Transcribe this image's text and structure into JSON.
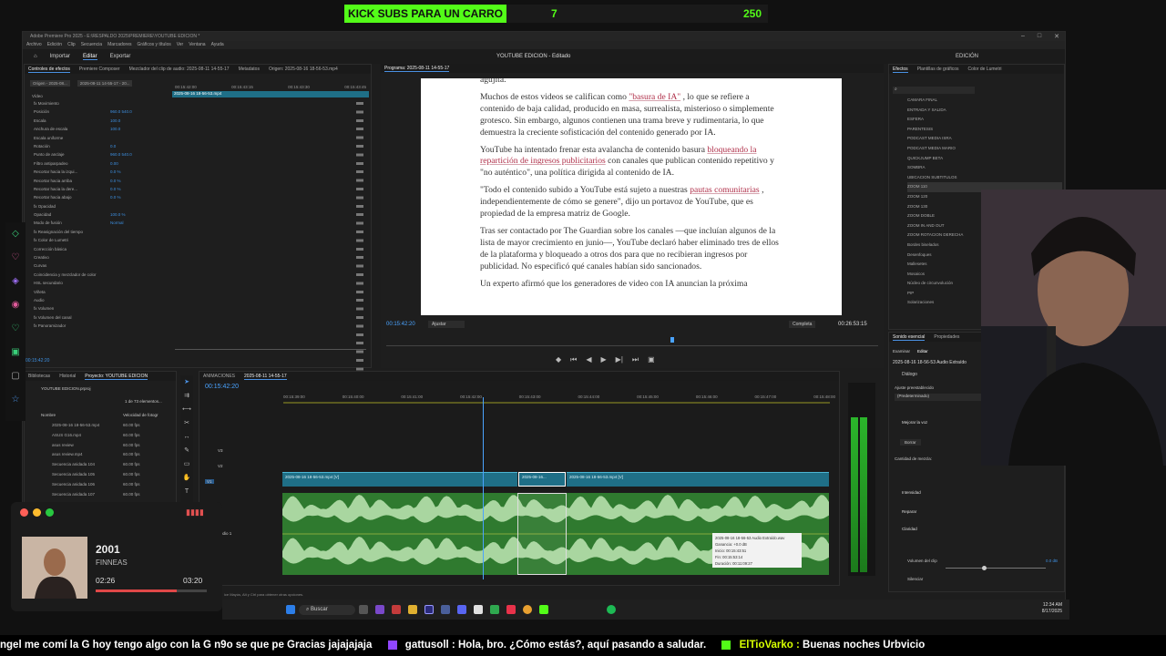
{
  "overlay": {
    "goal_label": "KICK SUBS PARA UN CARRO",
    "goal_current": "7",
    "goal_target": "250"
  },
  "window": {
    "title": "Adobe Premiere Pro 2025 - E:\\RESPALDO 2025\\PREMIERE\\YOUTUBE EDICION *",
    "center_title": "YOUTUBE EDICION - Editado",
    "menu": [
      "Archivo",
      "Edición",
      "Clip",
      "Secuencia",
      "Marcadores",
      "Gráficos y títulos",
      "Ver",
      "Ventana",
      "Ayuda"
    ],
    "workspaces": [
      "Importar",
      "Editar",
      "Exportar"
    ],
    "edicion_label": "EDICIÓN"
  },
  "effect_controls": {
    "tabs": [
      "Controles de efectos",
      "Premiere Composer",
      "Mezclador del clip de audio: 2025-08-11 14-55-17",
      "Metadatos"
    ],
    "source_label": "Origen: 2025-08-16 18-56-53.mp4",
    "clip_a": "Origen - 2025-08...",
    "clip_b": "2025-08-11 14-55-17 - 20...",
    "ruler": [
      "00:15:42:00",
      "00:15:43:15",
      "00:15:43:30",
      "00:15:43:45"
    ],
    "clip_bar": "2025-08-16 18-56-53.mp4",
    "section_video": "Vídeo",
    "rows": [
      {
        "label": "fx Movimiento",
        "value": ""
      },
      {
        "label": "Posición",
        "value": "960.0    540.0"
      },
      {
        "label": "Escala",
        "value": "100.0"
      },
      {
        "label": "Anchura de escala",
        "value": "100.0"
      },
      {
        "label": "Escala uniforme",
        "value": ""
      },
      {
        "label": "Rotación",
        "value": "0.0"
      },
      {
        "label": "Punto de anclaje",
        "value": "960.0    540.0"
      },
      {
        "label": "Filtro antiparpadeo",
        "value": "0.00"
      },
      {
        "label": "Recortar hacia la izqui...",
        "value": "0.0 %"
      },
      {
        "label": "Recortar hacia arriba",
        "value": "0.0 %"
      },
      {
        "label": "Recortar hacia la dere...",
        "value": "0.0 %"
      },
      {
        "label": "Recortar hacia abajo",
        "value": "0.0 %"
      },
      {
        "label": "fx Opacidad",
        "value": ""
      },
      {
        "label": "Opacidad",
        "value": "100.0 %"
      },
      {
        "label": "Modo de fusión",
        "value": "Normal"
      },
      {
        "label": "fx Reasignación del tiempo",
        "value": ""
      },
      {
        "label": "fx Color de Lumetri",
        "value": ""
      },
      {
        "label": "Corrección básica",
        "value": ""
      },
      {
        "label": "Creativo",
        "value": ""
      },
      {
        "label": "Curvas",
        "value": ""
      },
      {
        "label": "Coincidencia y mezclador de color",
        "value": ""
      },
      {
        "label": "HSL secundario",
        "value": ""
      },
      {
        "label": "Viñeta",
        "value": ""
      },
      {
        "label": "Audio",
        "value": ""
      },
      {
        "label": "fx Volumen",
        "value": ""
      },
      {
        "label": "fx Volumen del canal",
        "value": ""
      },
      {
        "label": "fx Panoramizador",
        "value": ""
      }
    ],
    "timecode": "00:15:42:20"
  },
  "program": {
    "tab": "Programa: 2025-08-11 14-55-17",
    "timecode": "00:15:42:20",
    "fit": "Ajustar",
    "quality": "Completa",
    "duration": "00:26:53:15"
  },
  "article": {
    "top_fragment": "agujita.",
    "p1_a": "Muchos de estos videos se califican como ",
    "p1_link": "\"basura de IA\"",
    "p1_b": " , lo que se refiere a contenido de baja calidad, producido en masa, surrealista, misterioso o simplemente grotesco. Sin embargo, algunos contienen una trama breve y rudimentaria, lo que demuestra la creciente sofisticación del contenido generado por IA.",
    "p2_a": "YouTube ha intentado frenar esta avalancha de contenido basura ",
    "p2_link": "bloqueando la repartición de ingresos publicitarios",
    "p2_b": " con canales que publican contenido repetitivo y \"no auténtico\", una política dirigida al contenido de IA.",
    "p3_a": "\"Todo el contenido subido a YouTube está sujeto a nuestras ",
    "p3_link": "pautas comunitarias",
    "p3_b": " , independientemente de cómo se genere\", dijo un portavoz de YouTube, que es propiedad de la empresa matriz de Google.",
    "p4": "Tras ser contactado por The Guardian sobre los canales —que incluían algunos de la lista de mayor crecimiento en junio—, YouTube declaró haber eliminado tres de ellos de la plataforma y bloqueado a otros dos para que no recibieran ingresos por publicidad. No especificó qué canales habían sido sancionados.",
    "p5": "Un experto afirmó que los generadores de video con IA anuncian la próxima"
  },
  "effects": {
    "tabs": [
      "Efectos",
      "Plantillas de gráficos",
      "Color de Lumetri"
    ],
    "items": [
      "CAMARA FINAL",
      "ENTRADA Y SALIDA",
      "ESFERA",
      "PARENTESIS",
      "PODCAST MEDIA ISRA",
      "PODCAST MEDIA MARIO",
      "QUICKJUMP BETA",
      "SOMBRA",
      "UBICACION SUBTITULOS",
      "ZOOM 110",
      "ZOOM 120",
      "ZOOM 130",
      "ZOOM DOBLE",
      "ZOOM IN AND OUT",
      "ZOOM ROTACION DERECHA",
      "Bordes biselados",
      "Desenfoques",
      "Mallesetes",
      "Mosaicos",
      "Núcleo de circunvolución",
      "PIP",
      "Solarizaciones"
    ]
  },
  "essential_sound": {
    "tabs": [
      "Sonido esencial",
      "Propiedades"
    ],
    "subtabs": [
      "Examinar",
      "Editar"
    ],
    "clip": "2025-08-16 18-56-53 Audio Extraído",
    "type": "Diálogo",
    "preset_label": "Ajuste preestablecido",
    "preset_value": "(Predeterminado)",
    "voice": "Mejorar la voz",
    "reset": "Borrar",
    "mix_label": "Cantidad de mezcla:",
    "sections": [
      "Intensidad",
      "Reparar",
      "Claridad"
    ],
    "clip_volume": "Volumen del clip",
    "clip_volume_value": "0.0 dB",
    "silence": "Silenciar"
  },
  "project": {
    "tabs": [
      "Bibliotecas",
      "Historial",
      "Proyecto: YOUTUBE EDICION"
    ],
    "name": "YOUTUBE EDICION.prproj",
    "count": "1 de 73 elementos...",
    "col_name": "Nombre",
    "col_rate": "Velocidad de fotogr",
    "items": [
      {
        "name": "2025-08-16 18-56-53.mp4",
        "rate": "60.00 fps"
      },
      {
        "name": "ASUS G16.mp4",
        "rate": "60.00 fps"
      },
      {
        "name": "asus review",
        "rate": "60.00 fps"
      },
      {
        "name": "asus review.mp4",
        "rate": "60.00 fps"
      },
      {
        "name": "Secuencia anidada 104",
        "rate": "60.00 fps"
      },
      {
        "name": "Secuencia anidada 105",
        "rate": "60.00 fps"
      },
      {
        "name": "Secuencia anidada 106",
        "rate": "60.00 fps"
      },
      {
        "name": "Secuencia anidada 107",
        "rate": "60.00 fps"
      }
    ]
  },
  "timeline": {
    "tabs": [
      "ANIMACIONES",
      "2025-08-11 14-55-17"
    ],
    "timecode": "00:15:42:20",
    "ruler": [
      "00:15:39:00",
      "00:15:40:00",
      "00:15:41:00",
      "00:15:42:00",
      "00:15:43:00",
      "00:15:44:00",
      "00:15:45:00",
      "00:15:46:00",
      "00:15:47:00",
      "00:15:48:00"
    ],
    "tracks": [
      "V3",
      "V2",
      "V1",
      "A1"
    ],
    "audio_label": "Audio 1",
    "clip_v1": "2025-08-16 18-56-53.mp4 [V]",
    "clip_v2": "2025-08-16...",
    "clip_v3": "2025-08-16 18-56-53.mp4 [V]",
    "tooltip": [
      "2025-08-16 18-56-53 Audio Extraído.wav",
      "Ganancia: +0.0 dB",
      "Inicio: 00:15:43:51",
      "Fin: 00:15:53:14",
      "Duración: 00:11:09:27"
    ],
    "meter_scale": [
      "0",
      "-6",
      "-12",
      "-18",
      "-24",
      "-30",
      "-36",
      "-42",
      "-48",
      "-54"
    ]
  },
  "taskbar": {
    "search": "Buscar",
    "time": "12:34 AM",
    "date": "8/17/2025",
    "hint": "ice Mayús, Alt y Ctrl para obtener otras opciones."
  },
  "music": {
    "title": "2001",
    "artist": "FINNEAS",
    "elapsed": "02:26",
    "total": "03:20",
    "progress": 0.73
  },
  "ticker": {
    "text": "ngel  me comí la G  hoy tengo algo con la G n9o se que pe  Gracias jajajajaja",
    "msg1_user": "gattusoll :",
    "msg1": " Hola, bro. ¿Cómo estás?, aquí pasando a saludar.",
    "msg2_user": "ElTioVarko :",
    "msg2": " Buenas noches Urbvicio"
  },
  "colors": {
    "accent": "#4a90e2",
    "kick_green": "#53fc18",
    "video_clip": "#1f6f87",
    "audio_clip": "#2f7a2f",
    "link": "#b0304a"
  }
}
